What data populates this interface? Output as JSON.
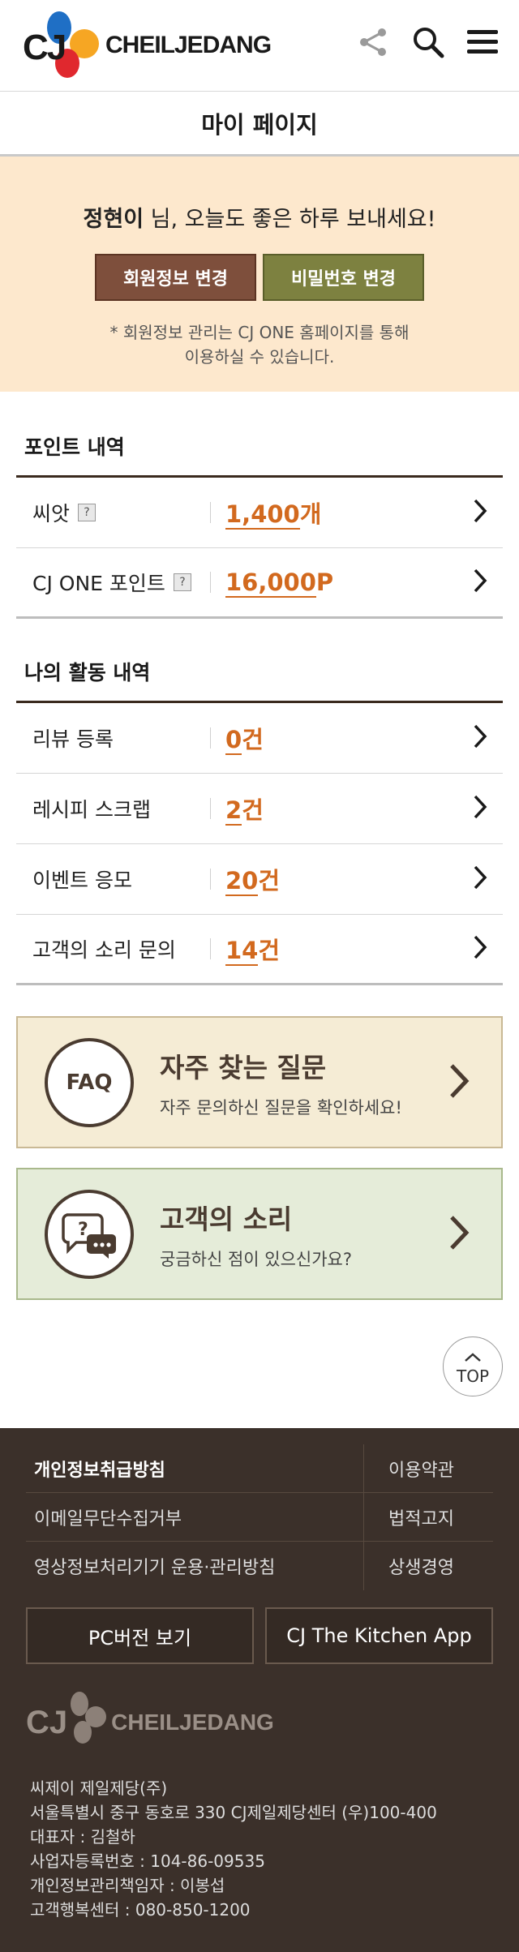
{
  "header": {
    "logo_cj": "CJ",
    "logo_text": "CHEILJEDANG",
    "icons": [
      "share-icon",
      "search-icon",
      "menu-icon"
    ]
  },
  "page_title": "마이 페이지",
  "greeting": {
    "name": "정현이",
    "message": " 님, 오늘도 좋은 하루 보내세요!",
    "btn_profile": "회원정보 변경",
    "btn_password": "비밀번호 변경",
    "note_line1": "* 회원정보 관리는 CJ ONE 홈페이지를 통해",
    "note_line2": "이용하실 수 있습니다."
  },
  "points": {
    "title": "포인트 내역",
    "rows": [
      {
        "label": "씨앗",
        "help": "?",
        "num": "1,400",
        "unit": "개"
      },
      {
        "label": "CJ ONE 포인트",
        "help": "?",
        "num": "16,000",
        "unit": "P"
      }
    ]
  },
  "activity": {
    "title": "나의 활동 내역",
    "rows": [
      {
        "label": "리뷰 등록",
        "num": "0",
        "unit": "건"
      },
      {
        "label": "레시피 스크랩",
        "num": "2",
        "unit": "건"
      },
      {
        "label": "이벤트 응모",
        "num": "20",
        "unit": "건"
      },
      {
        "label": "고객의 소리 문의",
        "num": "14",
        "unit": "건"
      }
    ]
  },
  "faq": {
    "badge": "FAQ",
    "title": "자주 찾는 질문",
    "sub": "자주 문의하신 질문을 확인하세요!"
  },
  "voc": {
    "title": "고객의 소리",
    "sub": "궁금하신 점이 있으신가요?"
  },
  "top_label": "TOP",
  "footer": {
    "links": [
      {
        "left": "개인정보취급방침",
        "right": "이용약관"
      },
      {
        "left": "이메일무단수집거부",
        "right": "법적고지"
      },
      {
        "left": "영상정보처리기기 운용·관리방침",
        "right": "상생경영"
      }
    ],
    "btn_pc": "PC버전 보기",
    "btn_app": "CJ The Kitchen App",
    "logo_cj": "CJ",
    "logo_text": "CHEILJEDANG",
    "info": [
      "씨제이 제일제당(주)",
      "서울특별시 중구 동호로 330 CJ제일제당센터 (우)100-400",
      "대표자 : 김철하",
      "사업자등록번호 : 104-86-09535",
      "개인정보관리책임자 : 이봉섭",
      "고객행복센터 : 080-850-1200"
    ]
  },
  "colors": {
    "accent_orange": "#d2691e",
    "greeting_bg": "#fde8cd",
    "btn_brown": "#7e4f3c",
    "btn_olive": "#7d8140",
    "footer_bg": "#3b302a"
  }
}
